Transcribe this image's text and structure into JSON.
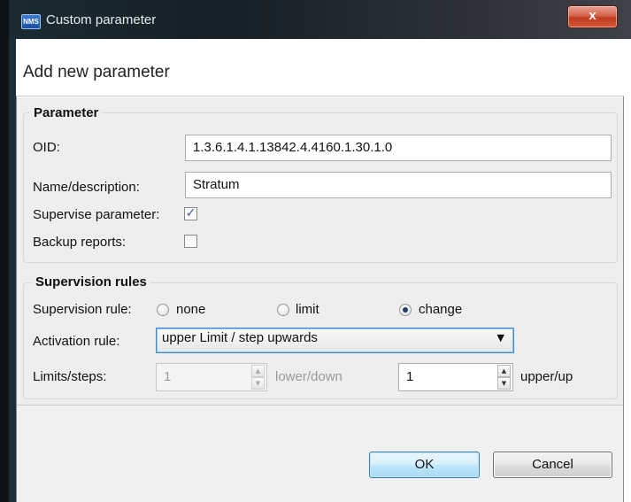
{
  "window": {
    "app_icon_text": "NMS",
    "title": "Custom parameter",
    "close_glyph": "x"
  },
  "heading": "Add new parameter",
  "parameter_group": {
    "title": "Parameter",
    "oid_label": "OID:",
    "oid_value": "1.3.6.1.4.1.13842.4.4160.1.30.1.0",
    "name_label": "Name/description:",
    "name_value": "Stratum",
    "supervise_label": "Supervise parameter:",
    "supervise_checked": true,
    "supervise_glyph": "✓",
    "backup_label": "Backup reports:",
    "backup_checked": false
  },
  "supervision_group": {
    "title": "Supervision rules",
    "rule_label": "Supervision rule:",
    "rule_options": [
      "none",
      "limit",
      "change"
    ],
    "rule_selected": "change",
    "activation_label": "Activation rule:",
    "activation_value": "upper Limit / step upwards",
    "limits_label": "Limits/steps:",
    "lower_value": "1",
    "lower_label": "lower/down",
    "lower_enabled": false,
    "upper_value": "1",
    "upper_label": "upper/up"
  },
  "buttons": {
    "ok": "OK",
    "cancel": "Cancel"
  },
  "icons": {
    "app": "nms-app-icon",
    "close": "close-icon",
    "dropdown": "chevron-down-icon",
    "spin_up": "triangle-up-icon",
    "spin_down": "triangle-down-icon"
  },
  "colors": {
    "title_bar": "#162026",
    "close_button": "#c94a2e",
    "accent_blue": "#3c7fb1",
    "body_bg": "#eeeeee"
  }
}
